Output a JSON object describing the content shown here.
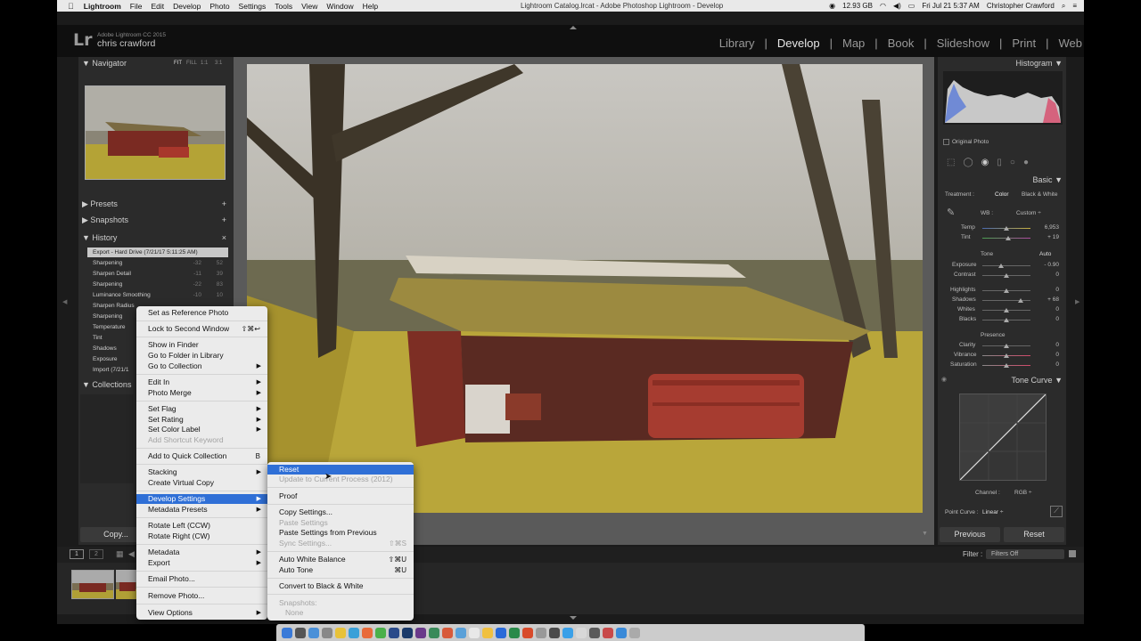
{
  "menubar": {
    "app_name": "Lightroom",
    "items": [
      "File",
      "Edit",
      "Develop",
      "Photo",
      "Settings",
      "Tools",
      "View",
      "Window",
      "Help"
    ],
    "window_title": "Lightroom Catalog.lrcat - Adobe Photoshop Lightroom - Develop",
    "disk_space": "12.93 GB",
    "clock": "Fri Jul 21  5:37 AM",
    "user": "Christopher Crawford"
  },
  "identity": {
    "logo": "Lr",
    "version": "Adobe Lightroom CC 2015",
    "user": "chris crawford"
  },
  "modules": [
    "Library",
    "Develop",
    "Map",
    "Book",
    "Slideshow",
    "Print",
    "Web"
  ],
  "active_module": "Develop",
  "left_panel": {
    "navigator": {
      "title": "Navigator",
      "zoom_options": [
        "FIT",
        "FILL",
        "1:1",
        "3:1"
      ]
    },
    "presets": "Presets",
    "snapshots": "Snapshots",
    "history": {
      "title": "History",
      "items": [
        {
          "label": "Export - Hard Drive (7/21/17 5:11:25 AM)",
          "a": "",
          "b": ""
        },
        {
          "label": "Sharpening",
          "a": "-32",
          "b": "52"
        },
        {
          "label": "Sharpen Detail",
          "a": "-11",
          "b": "39"
        },
        {
          "label": "Sharpening",
          "a": "-22",
          "b": "83"
        },
        {
          "label": "Luminance Smoothing",
          "a": "-10",
          "b": "10"
        },
        {
          "label": "Sharpen Radius",
          "a": "",
          "b": ""
        },
        {
          "label": "Sharpening",
          "a": "",
          "b": ""
        },
        {
          "label": "Temperature",
          "a": "",
          "b": ""
        },
        {
          "label": "Tint",
          "a": "",
          "b": ""
        },
        {
          "label": "Shadows",
          "a": "",
          "b": ""
        },
        {
          "label": "Exposure",
          "a": "",
          "b": ""
        },
        {
          "label": "Import (7/21/1",
          "a": "",
          "b": ""
        }
      ]
    },
    "collections": "Collections",
    "copy_button": "Copy..."
  },
  "context_menu": {
    "items": [
      {
        "label": "Set as Reference Photo"
      },
      {
        "label": "Lock to Second Window",
        "shortcut": "⇧⌘↩"
      },
      {
        "label": "Show in Finder"
      },
      {
        "label": "Go to Folder in Library"
      },
      {
        "label": "Go to Collection",
        "arrow": "▶"
      },
      {
        "label": "Edit In",
        "arrow": "▶"
      },
      {
        "label": "Photo Merge",
        "arrow": "▶"
      },
      {
        "label": "Set Flag",
        "arrow": "▶"
      },
      {
        "label": "Set Rating",
        "arrow": "▶"
      },
      {
        "label": "Set Color Label",
        "arrow": "▶"
      },
      {
        "label": "Add Shortcut Keyword"
      },
      {
        "label": "Add to Quick Collection",
        "shortcut": "B"
      },
      {
        "label": "Stacking",
        "arrow": "▶"
      },
      {
        "label": "Create Virtual Copy"
      },
      {
        "label": "Develop Settings",
        "arrow": "▶"
      },
      {
        "label": "Metadata Presets",
        "arrow": "▶"
      },
      {
        "label": "Rotate Left (CCW)"
      },
      {
        "label": "Rotate Right (CW)"
      },
      {
        "label": "Metadata",
        "arrow": "▶"
      },
      {
        "label": "Export",
        "arrow": "▶"
      },
      {
        "label": "Email Photo..."
      },
      {
        "label": "Remove Photo..."
      },
      {
        "label": "View Options",
        "arrow": "▶"
      }
    ]
  },
  "submenu": {
    "items": [
      {
        "label": "Reset"
      },
      {
        "label": "Update to Current Process (2012)"
      },
      {
        "label": "Proof"
      },
      {
        "label": "Copy Settings..."
      },
      {
        "label": "Paste Settings"
      },
      {
        "label": "Paste Settings from Previous"
      },
      {
        "label": "Sync Settings...",
        "shortcut": "⇧⌘S"
      },
      {
        "label": "Auto White Balance",
        "shortcut": "⇧⌘U"
      },
      {
        "label": "Auto Tone",
        "shortcut": "⌘U"
      },
      {
        "label": "Convert to Black & White"
      },
      {
        "label": "Snapshots:"
      },
      {
        "label": "None"
      }
    ]
  },
  "right_panel": {
    "histogram": "Histogram",
    "original_photo": "Original Photo",
    "basic": {
      "title": "Basic",
      "treatment_label": "Treatment :",
      "color": "Color",
      "bw": "Black & White",
      "wb_label": "WB :",
      "wb_value": "Custom ÷",
      "temp": {
        "label": "Temp",
        "value": "6,953"
      },
      "tint": {
        "label": "Tint",
        "value": "+ 19"
      },
      "tone_label": "Tone",
      "auto": "Auto",
      "exposure": {
        "label": "Exposure",
        "value": "- 0.90"
      },
      "contrast": {
        "label": "Contrast",
        "value": "0"
      },
      "highlights": {
        "label": "Highlights",
        "value": "0"
      },
      "shadows": {
        "label": "Shadows",
        "value": "+ 68"
      },
      "whites": {
        "label": "Whites",
        "value": "0"
      },
      "blacks": {
        "label": "Blacks",
        "value": "0"
      },
      "presence_label": "Presence",
      "clarity": {
        "label": "Clarity",
        "value": "0"
      },
      "vibrance": {
        "label": "Vibrance",
        "value": "0"
      },
      "saturation": {
        "label": "Saturation",
        "value": "0"
      }
    },
    "tone_curve": {
      "title": "Tone Curve",
      "channel_label": "Channel :",
      "channel_value": "RGB ÷",
      "point_curve_label": "Point Curve :",
      "point_curve_value": "Linear ÷"
    },
    "previous_button": "Previous",
    "reset_button": "Reset"
  },
  "filmstrip": {
    "filter_label": "Filter :",
    "filter_value": "Filters Off"
  }
}
